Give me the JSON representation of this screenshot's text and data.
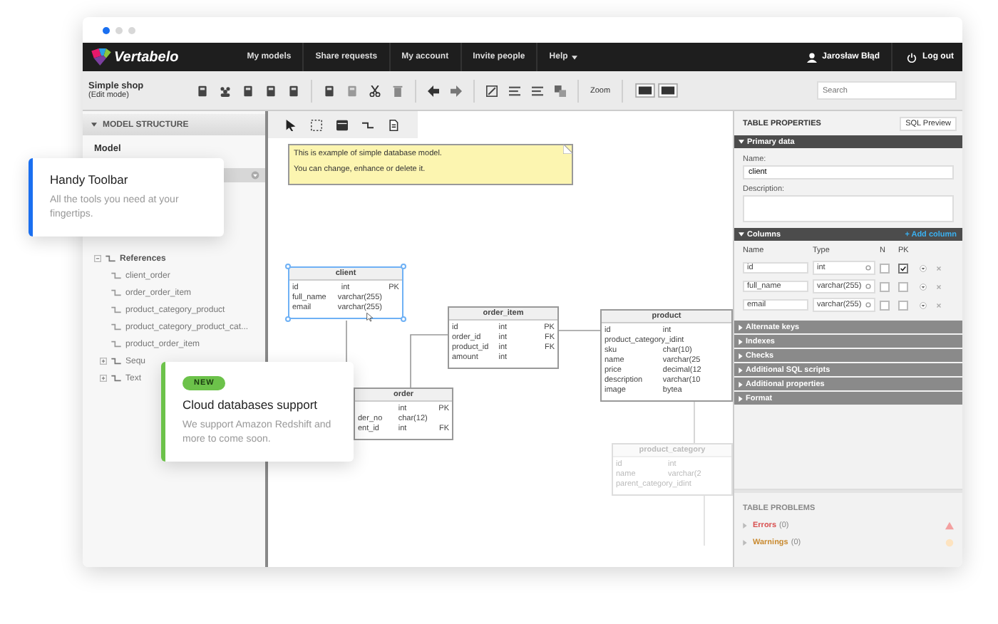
{
  "navbar": {
    "logo": "Vertabelo",
    "menu": [
      {
        "label": "My models",
        "kind": "link"
      },
      {
        "label": "Share requests",
        "kind": "link"
      },
      {
        "label": "My account",
        "kind": "link"
      },
      {
        "label": "Invite people",
        "kind": "link"
      },
      {
        "label": "Help",
        "kind": "dropdown"
      }
    ],
    "user": "Jarosław Błąd",
    "logout": "Log out"
  },
  "toolbar": {
    "model_name": "Simple shop",
    "mode": "(Edit mode)",
    "zoom": "Zoom",
    "search": {
      "placeholder": "Search"
    }
  },
  "model_structure": {
    "title": "MODEL STRUCTURE",
    "root": "Model",
    "tree": [
      {
        "label": "References",
        "expanded": true,
        "children": [
          {
            "label": "client_order"
          },
          {
            "label": "order_order_item"
          },
          {
            "label": "product_category_product"
          },
          {
            "label": "product_category_product_cat..."
          },
          {
            "label": "product_order_item"
          }
        ]
      },
      {
        "label": "Sequ",
        "expanded": false
      },
      {
        "label": "Text",
        "expanded": false
      }
    ]
  },
  "canvas": {
    "note": [
      "This is example of simple database model.",
      "You can change, enhance or delete it."
    ],
    "tables": [
      {
        "name": "client",
        "selected": true,
        "columns": [
          {
            "name": "id",
            "type": "int",
            "key": "PK"
          },
          {
            "name": "full_name",
            "type": "varchar(255)"
          },
          {
            "name": "email",
            "type": "varchar(255)"
          }
        ]
      },
      {
        "name": "order_item",
        "selected": false,
        "columns": [
          {
            "name": "id",
            "type": "int",
            "key": "PK"
          },
          {
            "name": "order_id",
            "type": "int",
            "key": "FK"
          },
          {
            "name": "product_id",
            "type": "int",
            "key": "FK"
          },
          {
            "name": "amount",
            "type": "int"
          }
        ]
      },
      {
        "name": "product",
        "selected": false,
        "columns": [
          {
            "name": "id",
            "type": "int"
          },
          {
            "name": "product_category_id",
            "type": "int"
          },
          {
            "name": "sku",
            "type": "char(10)"
          },
          {
            "name": "name",
            "type": "varchar(25"
          },
          {
            "name": "price",
            "type": "decimal(12"
          },
          {
            "name": "description",
            "type": "varchar(10"
          },
          {
            "name": "image",
            "type": "bytea"
          }
        ]
      },
      {
        "name": "order",
        "selected": false,
        "columns": [
          {
            "type": "int",
            "key": "PK"
          },
          {
            "name": "der_no",
            "type": "char(12)"
          },
          {
            "name": "ent_id",
            "type": "int",
            "key": "FK"
          }
        ]
      },
      {
        "name": "product_category",
        "selected": false,
        "columns": [
          {
            "name": "id",
            "type": "int"
          },
          {
            "name": "name",
            "type": "varchar(2"
          },
          {
            "name": "parent_category_id",
            "type": "int"
          }
        ]
      }
    ]
  },
  "table_properties": {
    "title": "TABLE PROPERTIES",
    "sql_preview": "SQL Preview",
    "primary_data": {
      "title": "Primary data",
      "name_label": "Name:",
      "name_value": "client",
      "description_label": "Description:"
    },
    "columns_section": {
      "title": "Columns",
      "add": "+ Add column",
      "headers": [
        "Name",
        "Type",
        "N",
        "PK"
      ]
    },
    "columns": [
      {
        "name": "id",
        "type": "int",
        "n": false,
        "pk": true
      },
      {
        "name": "full_name",
        "type": "varchar(255)",
        "n": false,
        "pk": false
      },
      {
        "name": "email",
        "type": "varchar(255)",
        "n": false,
        "pk": false
      }
    ],
    "sections": [
      "Alternate keys",
      "Indexes",
      "Checks",
      "Additional SQL scripts",
      "Additional properties",
      "Format"
    ],
    "problems": {
      "title": "TABLE PROBLEMS",
      "items": [
        {
          "label": "Errors",
          "count": "(0)",
          "kind": "error"
        },
        {
          "label": "Warnings",
          "count": "(0)",
          "kind": "warning"
        }
      ]
    }
  },
  "callouts": [
    {
      "title": "Handy Toolbar",
      "text": "All the tools you need at your fingertips.",
      "color": "#1a6ff0"
    },
    {
      "badge": "NEW",
      "title": "Cloud databases support",
      "text": "We support Amazon Redshift and more to come soon.",
      "color": "#6cc24a"
    }
  ]
}
